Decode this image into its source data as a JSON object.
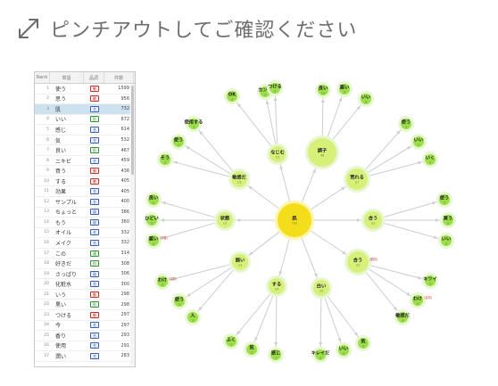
{
  "header": {
    "title": "ピンチアウトしてご確認ください",
    "icon": "pinch-expand-icon"
  },
  "table": {
    "columns": [
      "Rank",
      "単語",
      "品詞",
      "件数"
    ],
    "rows": [
      {
        "rank": "1",
        "word": "使う",
        "pos": "動",
        "pos_type": "verb",
        "count": "1599"
      },
      {
        "rank": "2",
        "word": "思う",
        "pos": "動",
        "pos_type": "verb",
        "count": "956"
      },
      {
        "rank": "3",
        "word": "肌",
        "pos": "名",
        "pos_type": "noun",
        "count": "732",
        "selected": true
      },
      {
        "rank": "4",
        "word": "いい",
        "pos": "形",
        "pos_type": "adj",
        "count": "672"
      },
      {
        "rank": "5",
        "word": "感じ",
        "pos": "名",
        "pos_type": "noun",
        "count": "614"
      },
      {
        "rank": "6",
        "word": "気",
        "pos": "名",
        "pos_type": "noun",
        "count": "532"
      },
      {
        "rank": "7",
        "word": "良い",
        "pos": "形",
        "pos_type": "adj",
        "count": "467"
      },
      {
        "rank": "8",
        "word": "ニキビ",
        "pos": "名",
        "pos_type": "noun",
        "count": "459"
      },
      {
        "rank": "9",
        "word": "買う",
        "pos": "動",
        "pos_type": "verb",
        "count": "436"
      },
      {
        "rank": "10",
        "word": "する",
        "pos": "動",
        "pos_type": "verb",
        "count": "405"
      },
      {
        "rank": "11",
        "word": "効果",
        "pos": "名",
        "pos_type": "noun",
        "count": "405"
      },
      {
        "rank": "12",
        "word": "サンプル",
        "pos": "名",
        "pos_type": "noun",
        "count": "400"
      },
      {
        "rank": "13",
        "word": "ちょっと",
        "pos": "副",
        "pos_type": "noun",
        "count": "386"
      },
      {
        "rank": "14",
        "word": "もう",
        "pos": "副",
        "pos_type": "noun",
        "count": "360"
      },
      {
        "rank": "15",
        "word": "オイル",
        "pos": "名",
        "pos_type": "noun",
        "count": "332"
      },
      {
        "rank": "16",
        "word": "メイク",
        "pos": "名",
        "pos_type": "noun",
        "count": "332"
      },
      {
        "rank": "17",
        "word": "この",
        "pos": "連",
        "pos_type": "adj",
        "count": "314"
      },
      {
        "rank": "18",
        "word": "好きだ",
        "pos": "形",
        "pos_type": "adj",
        "count": "308"
      },
      {
        "rank": "19",
        "word": "さっぱり",
        "pos": "副",
        "pos_type": "noun",
        "count": "306"
      },
      {
        "rank": "20",
        "word": "化粧水",
        "pos": "名",
        "pos_type": "noun",
        "count": "300"
      },
      {
        "rank": "21",
        "word": "いう",
        "pos": "動",
        "pos_type": "verb",
        "count": "298"
      },
      {
        "rank": "22",
        "word": "黒い",
        "pos": "形",
        "pos_type": "adj",
        "count": "298"
      },
      {
        "rank": "23",
        "word": "つける",
        "pos": "動",
        "pos_type": "verb",
        "count": "297"
      },
      {
        "rank": "24",
        "word": "今",
        "pos": "名",
        "pos_type": "noun",
        "count": "297"
      },
      {
        "rank": "25",
        "word": "香り",
        "pos": "名",
        "pos_type": "noun",
        "count": "293"
      },
      {
        "rank": "26",
        "word": "使用",
        "pos": "名",
        "pos_type": "noun",
        "count": "291"
      },
      {
        "rank": "27",
        "word": "潤い",
        "pos": "名",
        "pos_type": "noun",
        "count": "283"
      }
    ]
  },
  "graph": {
    "center": {
      "label": "肌",
      "count": "732"
    },
    "hubs": [
      {
        "id": "h_naji",
        "label": "なじむ",
        "count": "12"
      },
      {
        "id": "h_chosi",
        "label": "調子",
        "count": "46"
      },
      {
        "id": "h_are",
        "label": "荒れる",
        "count": "27"
      },
      {
        "id": "h_au",
        "label": "合う",
        "count": "23"
      },
      {
        "id": "h_au2",
        "label": "合う",
        "count": "22",
        "pos": "(動詞)"
      },
      {
        "id": "h_shiroi",
        "label": "白い",
        "count": "15"
      },
      {
        "id": "h_suru",
        "label": "する",
        "count": "14"
      },
      {
        "id": "h_yowai",
        "label": "弱い",
        "count": "13"
      },
      {
        "id": "h_jotai",
        "label": "状態",
        "count": "13"
      },
      {
        "id": "h_binkan",
        "label": "敏感だ",
        "count": "13"
      }
    ],
    "leaves": [
      {
        "hub": "h_naji",
        "label": "カンジ",
        "count": "3",
        "pos": "(名詞)"
      },
      {
        "hub": "h_naji",
        "label": "つける",
        "count": "3"
      },
      {
        "hub": "h_naji",
        "label": "OK",
        "count": "3"
      },
      {
        "hub": "h_chosi",
        "label": "良い",
        "count": "14"
      },
      {
        "hub": "h_chosi",
        "label": "悪い",
        "count": "4"
      },
      {
        "hub": "h_chosi",
        "label": "いい",
        "count": "8"
      },
      {
        "hub": "h_are",
        "label": "使う",
        "count": "3"
      },
      {
        "hub": "h_are",
        "label": "いい",
        "count": "3"
      },
      {
        "hub": "h_are",
        "label": "いく",
        "count": "3"
      },
      {
        "hub": "h_au",
        "label": "使う",
        "count": "5"
      },
      {
        "hub": "h_au",
        "label": "買う",
        "count": "3"
      },
      {
        "hub": "h_au",
        "label": "いい",
        "count": "3"
      },
      {
        "hub": "h_au2",
        "label": "キツイ",
        "count": "3"
      },
      {
        "hub": "h_au2",
        "label": "わけ",
        "count": "3",
        "pos": "(名詞)"
      },
      {
        "hub": "h_au2",
        "label": "敏感だ",
        "count": "3"
      },
      {
        "hub": "h_shiroi",
        "label": "気",
        "count": "3"
      },
      {
        "hub": "h_shiroi",
        "label": "いい",
        "count": "3"
      },
      {
        "hub": "h_shiroi",
        "label": "キレイだ",
        "count": "3"
      },
      {
        "hub": "h_suru",
        "label": "ふく",
        "count": "3"
      },
      {
        "hub": "h_suru",
        "label": "気",
        "count": "3"
      },
      {
        "hub": "h_suru",
        "label": "感じ",
        "count": "3"
      },
      {
        "hub": "h_yowai",
        "label": "わけ",
        "count": "3",
        "pos": "(名詞)"
      },
      {
        "hub": "h_yowai",
        "label": "使う",
        "count": "3"
      },
      {
        "hub": "h_yowai",
        "label": "人",
        "count": "3"
      },
      {
        "hub": "h_jotai",
        "label": "良い",
        "count": "3"
      },
      {
        "hub": "h_jotai",
        "label": "ひどい",
        "count": "3"
      },
      {
        "hub": "h_jotai",
        "label": "悪い",
        "count": "3",
        "pos": "(形容)"
      },
      {
        "hub": "h_binkan",
        "label": "使用する",
        "count": "3"
      },
      {
        "hub": "h_binkan",
        "label": "使う",
        "count": "3"
      },
      {
        "hub": "h_binkan",
        "label": "そう",
        "count": "3"
      }
    ],
    "colors": {
      "center": "#f4dd1a",
      "center_ring": "#fff4a8",
      "hub": "#d6f07a",
      "leaf": "#9ddf4a",
      "ring": "#e7f7cf",
      "edge": "#cdcdcd"
    }
  }
}
